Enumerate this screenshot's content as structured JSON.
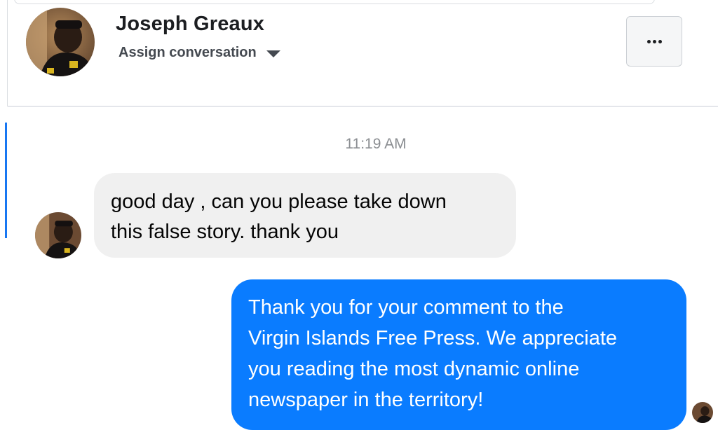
{
  "header": {
    "contact_name": "Joseph Greaux",
    "assign_label": "Assign conversation",
    "more_label": "More options"
  },
  "conversation": {
    "timestamp": "11:19 AM",
    "messages": [
      {
        "direction": "incoming",
        "text": "good day , can you please take down\nthis false story. thank you"
      },
      {
        "direction": "outgoing",
        "text": "Thank you for your comment to the\nVirgin Islands Free Press. We appreciate\nyou reading the most dynamic online\nnewspaper in the territory!"
      }
    ]
  },
  "icons": {
    "more": "more-horizontal-icon",
    "assign_caret": "caret-down-icon"
  },
  "colors": {
    "outgoing_bubble": "#0a7cff",
    "incoming_bubble": "#f0f0f0",
    "accent": "#1877f2"
  }
}
